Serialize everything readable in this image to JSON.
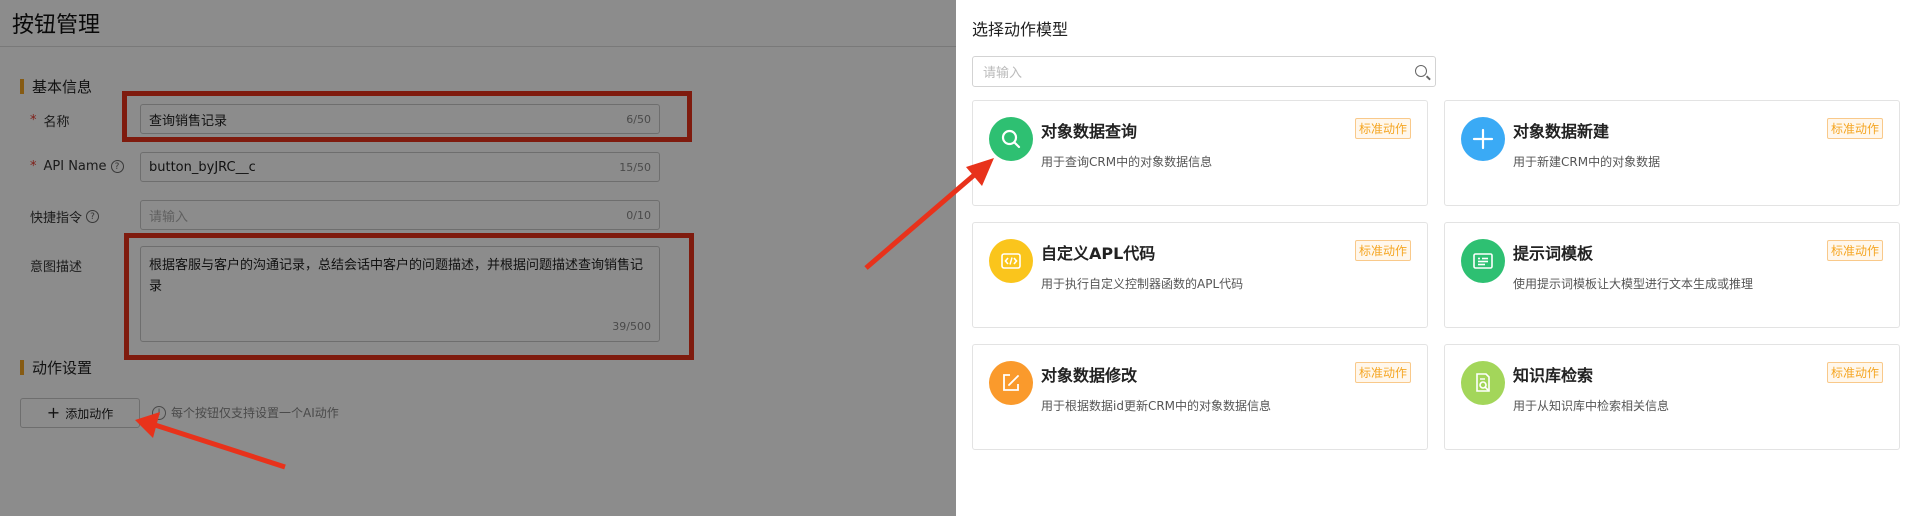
{
  "page": {
    "title": "按钮管理"
  },
  "basic_section": {
    "title": "基本信息",
    "name_label": "名称",
    "name_value": "查询销售记录",
    "name_counter": "6/50",
    "api_label": "API Name",
    "api_value": "button_byJRC__c",
    "api_counter": "15/50",
    "shortcut_label": "快捷指令",
    "shortcut_placeholder": "请输入",
    "shortcut_counter": "0/10",
    "intent_label": "意图描述",
    "intent_value": "根据客服与客户的沟通记录，总结会话中客户的问题描述，并根据问题描述查询销售记录",
    "intent_counter": "39/500"
  },
  "action_section": {
    "title": "动作设置",
    "add_button": "添加动作",
    "hint": "每个按钮仅支持设置一个AI动作"
  },
  "drawer": {
    "title": "选择动作模型",
    "search_placeholder": "请输入",
    "cards": [
      {
        "title": "对象数据查询",
        "desc": "用于查询CRM中的对象数据信息",
        "badge": "标准动作",
        "icon": "search-icon",
        "color": "#2ec072"
      },
      {
        "title": "对象数据新建",
        "desc": "用于新建CRM中的对象数据",
        "badge": "标准动作",
        "icon": "plus-icon",
        "color": "#3aaaf5"
      },
      {
        "title": "自定义APL代码",
        "desc": "用于执行自定义控制器函数的APL代码",
        "badge": "标准动作",
        "icon": "code-icon",
        "color": "#fac51c"
      },
      {
        "title": "提示词模板",
        "desc": "使用提示词模板让大模型进行文本生成或推理",
        "badge": "标准动作",
        "icon": "template-icon",
        "color": "#2ec072"
      },
      {
        "title": "对象数据修改",
        "desc": "用于根据数据id更新CRM中的对象数据信息",
        "badge": "标准动作",
        "icon": "edit-icon",
        "color": "#fa9a2c"
      },
      {
        "title": "知识库检索",
        "desc": "用于从知识库中检索相关信息",
        "badge": "标准动作",
        "icon": "knowledge-search-icon",
        "color": "#a3d65a"
      }
    ]
  },
  "annotation_color": "#e8321b"
}
